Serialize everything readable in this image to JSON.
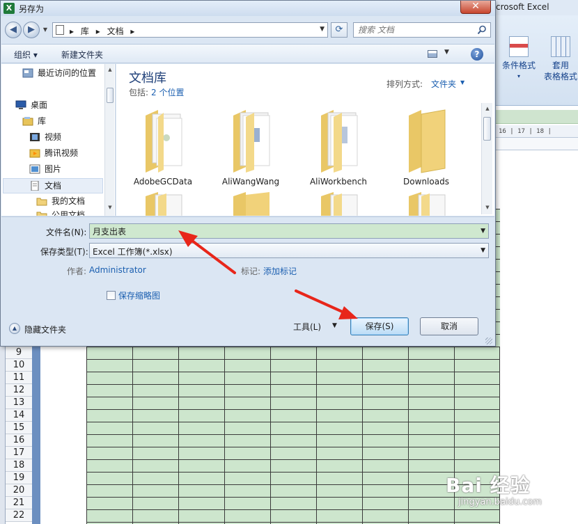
{
  "dialog": {
    "title": "另存为",
    "close_label": "✕",
    "nav": {
      "back_glyph": "◀",
      "forward_glyph": "▶",
      "breadcrumbs": [
        "▸",
        "库",
        "▸",
        "文档",
        "▸"
      ],
      "search_placeholder": "搜索 文档"
    },
    "toolbar": {
      "organize": "组织 ▾",
      "new_folder": "新建文件夹"
    },
    "sidebar": {
      "items": [
        {
          "label": "最近访问的位置",
          "icon": "recent-places-icon"
        },
        {
          "label": "桌面",
          "icon": "desktop-icon"
        },
        {
          "label": "库",
          "icon": "library-icon"
        },
        {
          "label": "视频",
          "icon": "video-icon"
        },
        {
          "label": "腾讯视频",
          "icon": "tencent-video-icon"
        },
        {
          "label": "图片",
          "icon": "pictures-icon"
        },
        {
          "label": "文档",
          "icon": "documents-icon"
        },
        {
          "label": "我的文档",
          "icon": "folder-icon"
        },
        {
          "label": "公用文档",
          "icon": "folder-icon"
        }
      ]
    },
    "library": {
      "title": "文档库",
      "includes_label": "包括:",
      "includes_link": "2 个位置",
      "arrange_label": "排列方式:",
      "arrange_value": "文件夹"
    },
    "folders": [
      "AdobeGCData",
      "AliWangWang",
      "AliWorkbench",
      "Downloads"
    ],
    "form": {
      "filename_label": "文件名(N):",
      "filename_value": "月支出表",
      "filetype_label": "保存类型(T):",
      "filetype_value": "Excel 工作簿(*.xlsx)",
      "author_label": "作者:",
      "author_value": "Administrator",
      "tags_label": "标记:",
      "tags_value": "添加标记",
      "thumbnail_label": "保存缩略图"
    },
    "footer": {
      "hide_folders": "隐藏文件夹",
      "tools": "工具(L)",
      "save": "保存(S)",
      "cancel": "取消"
    }
  },
  "excel": {
    "title": "crosoft Excel",
    "ribbon": {
      "conditional_format": "条件格式",
      "table_format_1": "套用",
      "table_format_2": "表格格式"
    },
    "ruler_text": "16 | 17 | 18 |",
    "row_numbers": [
      "9",
      "10",
      "11",
      "12",
      "13",
      "14",
      "15",
      "16",
      "17",
      "18",
      "19",
      "20",
      "21",
      "22"
    ]
  },
  "watermark": {
    "main": "Bai 经验",
    "sub": "jingyan.baidu.com"
  },
  "colors": {
    "accent_blue": "#1b5fb0",
    "grid_green": "#cde6cd",
    "arrow_red": "#e8261a",
    "dialog_bg": "#dbe6f3"
  }
}
